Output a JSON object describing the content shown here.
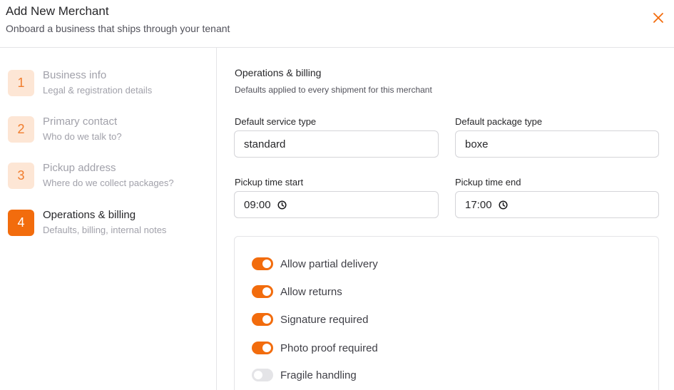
{
  "dialog": {
    "title": "Add New Merchant",
    "subtitle": "Onboard a business that ships through your tenant",
    "close_icon": "close-icon"
  },
  "steps": [
    {
      "number": "1",
      "title": "Business info",
      "description": "Legal & registration details",
      "active": false
    },
    {
      "number": "2",
      "title": "Primary contact",
      "description": "Who do we talk to?",
      "active": false
    },
    {
      "number": "3",
      "title": "Pickup address",
      "description": "Where do we collect packages?",
      "active": false
    },
    {
      "number": "4",
      "title": "Operations & billing",
      "description": "Defaults, billing, internal notes",
      "active": true
    }
  ],
  "section": {
    "title": "Operations & billing",
    "description": "Defaults applied to every shipment for this merchant"
  },
  "fields": {
    "service_type": {
      "label": "Default service type",
      "value": "standard"
    },
    "package_type": {
      "label": "Default package type",
      "value": "boxe"
    },
    "pickup_start": {
      "label": "Pickup time start",
      "value": "09:00",
      "icon": "clock-icon"
    },
    "pickup_end": {
      "label": "Pickup time end",
      "value": "17:00",
      "icon": "clock-icon"
    }
  },
  "toggles": [
    {
      "label": "Allow partial delivery",
      "on": true
    },
    {
      "label": "Allow returns",
      "on": true
    },
    {
      "label": "Signature required",
      "on": true
    },
    {
      "label": "Photo proof required",
      "on": true
    },
    {
      "label": "Fragile handling",
      "on": false
    }
  ],
  "colors": {
    "accent": "#f26c0d",
    "accent_light": "#fde6d5",
    "toggle_off": "#e4e4e7",
    "border": "#e4e4e7"
  }
}
